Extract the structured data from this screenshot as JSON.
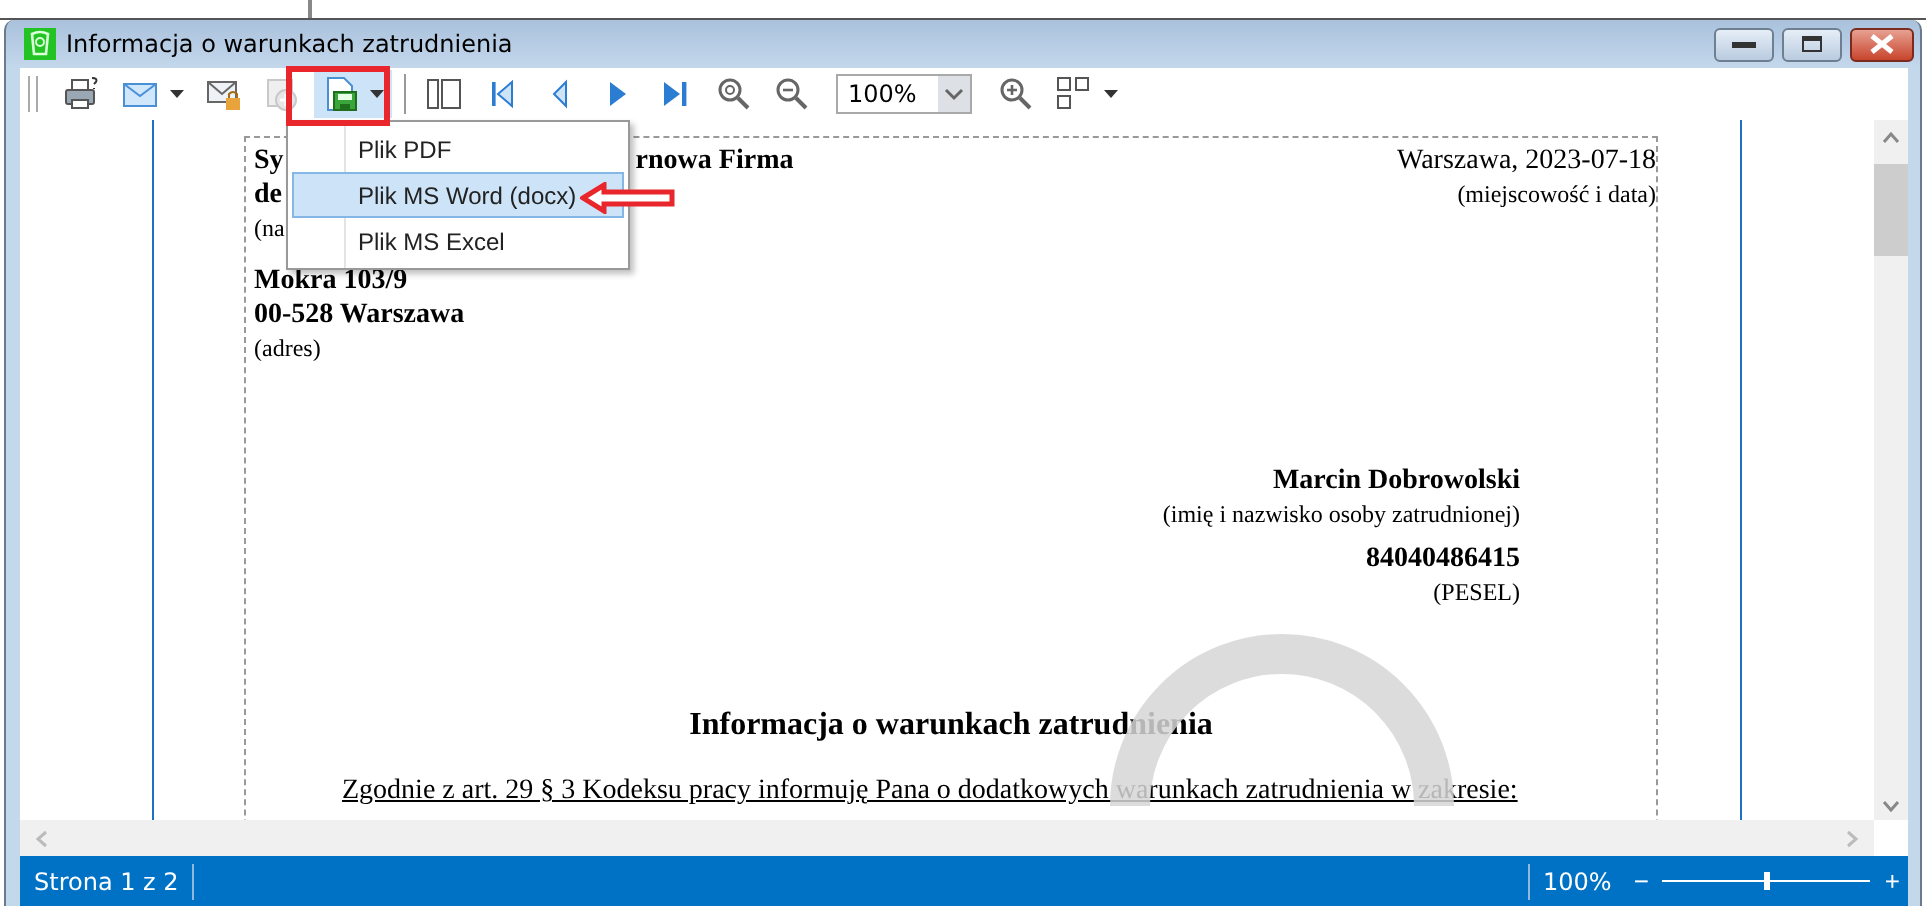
{
  "window": {
    "title": "Informacja o warunkach zatrudnienia"
  },
  "toolbar": [
    {
      "kind": "print",
      "dropdown": false,
      "disabled": false,
      "open": false
    },
    {
      "kind": "mail",
      "dropdown": true,
      "disabled": false,
      "open": false
    },
    {
      "kind": "mail-lock",
      "dropdown": false,
      "disabled": false,
      "open": false
    },
    {
      "kind": "add",
      "dropdown": false,
      "disabled": true,
      "open": false
    },
    {
      "kind": "save",
      "dropdown": true,
      "disabled": false,
      "open": true
    },
    {
      "kind": "separator"
    },
    {
      "kind": "layout",
      "dropdown": false,
      "disabled": false,
      "open": false
    },
    {
      "kind": "first",
      "dropdown": false,
      "disabled": false,
      "open": false
    },
    {
      "kind": "prev",
      "dropdown": false,
      "disabled": false,
      "open": false
    },
    {
      "kind": "next",
      "dropdown": false,
      "disabled": false,
      "open": false
    },
    {
      "kind": "last",
      "dropdown": false,
      "disabled": false,
      "open": false
    },
    {
      "kind": "zoom-find",
      "dropdown": false,
      "disabled": false,
      "open": false
    },
    {
      "kind": "zoom-out",
      "dropdown": false,
      "disabled": false,
      "open": false
    },
    {
      "kind": "zoom-select",
      "value": "100%"
    },
    {
      "kind": "zoom-in",
      "dropdown": false,
      "disabled": false,
      "open": false
    },
    {
      "kind": "pages",
      "dropdown": true,
      "disabled": false,
      "open": false
    }
  ],
  "save_menu": [
    {
      "label": "Plik PDF",
      "selected": false
    },
    {
      "label": "Plik MS Word (docx)",
      "selected": true
    },
    {
      "label": "Plik MS Excel",
      "selected": false
    }
  ],
  "letter": {
    "sender_name_start": "Sy",
    "sender_name_end": "rnowa Firma",
    "sender_line2_start": "de",
    "sender_caption_start": "(na",
    "sender_street": "Mokra 103/9",
    "sender_city": "00-528 Warszawa",
    "sender_caption": "(adres)",
    "place_date": "Warszawa, 2023-07-18",
    "place_date_caption": "(miejscowość i data)",
    "employee_name": "Marcin Dobrowolski",
    "employee_name_caption": "(imię i nazwisko osoby zatrudnionej)",
    "pesel": "84040486415",
    "pesel_caption": "(PESEL)",
    "heading": "Informacja o warunkach zatrudnienia",
    "intro": "Zgodnie z art. 29 § 3 Kodeksu pracy informuję Pana o dodatkowych warunkach zatrudnienia w zakresie:"
  },
  "status_bar": {
    "page": "Strona 1 z 2",
    "zoom": "100%",
    "zoom_out": "−",
    "zoom_in": "+",
    "zoom_slider": {
      "level": 0.5
    }
  }
}
